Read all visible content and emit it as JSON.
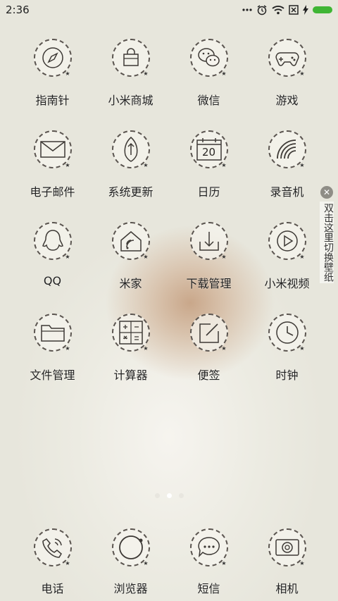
{
  "status_bar": {
    "time": "2:36",
    "icons": [
      "more-dots-icon",
      "alarm-icon",
      "wifi-icon",
      "no-sim-icon",
      "charging-icon",
      "battery-icon"
    ],
    "battery_color": "#3fb534"
  },
  "apps": [
    {
      "label": "指南针",
      "icon": "compass-icon"
    },
    {
      "label": "小米商城",
      "icon": "shopping-bag-icon"
    },
    {
      "label": "微信",
      "icon": "wechat-icon"
    },
    {
      "label": "游戏",
      "icon": "gamepad-icon"
    },
    {
      "label": "电子邮件",
      "icon": "envelope-icon"
    },
    {
      "label": "系统更新",
      "icon": "update-arrow-icon"
    },
    {
      "label": "日历",
      "icon": "calendar-icon",
      "day": "20"
    },
    {
      "label": "录音机",
      "icon": "sound-waves-icon"
    },
    {
      "label": "QQ",
      "icon": "qq-penguin-icon"
    },
    {
      "label": "米家",
      "icon": "smart-home-icon"
    },
    {
      "label": "下载管理",
      "icon": "download-icon"
    },
    {
      "label": "小米视频",
      "icon": "play-icon"
    },
    {
      "label": "文件管理",
      "icon": "folder-icon"
    },
    {
      "label": "计算器",
      "icon": "calculator-icon"
    },
    {
      "label": "便签",
      "icon": "note-pencil-icon"
    },
    {
      "label": "时钟",
      "icon": "clock-icon"
    }
  ],
  "page_indicator": {
    "count": 3,
    "active_index": 1
  },
  "dock": [
    {
      "label": "电话",
      "icon": "phone-icon"
    },
    {
      "label": "浏览器",
      "icon": "browser-globe-icon"
    },
    {
      "label": "短信",
      "icon": "message-bubble-icon"
    },
    {
      "label": "相机",
      "icon": "camera-icon"
    }
  ],
  "wallpaper_tip": {
    "text": "双击这里切换壁纸",
    "close_icon": "close-icon"
  }
}
